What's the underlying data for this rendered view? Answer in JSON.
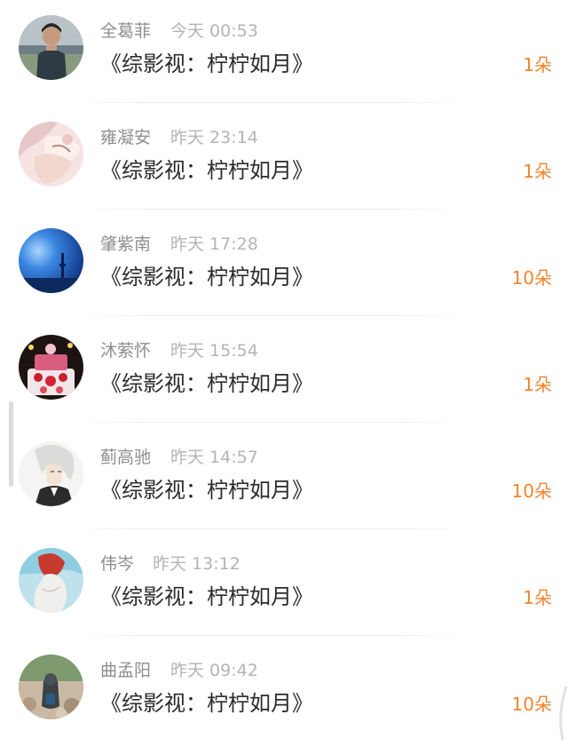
{
  "messages": [
    {
      "name": "全葛菲",
      "time": "今天 00:53",
      "title": "《综影视：柠柠如月》",
      "gift": "1朵",
      "avatar_icon": "avatar-man-outdoor"
    },
    {
      "name": "雍凝安",
      "time": "昨天 23:14",
      "title": "《综影视：柠柠如月》",
      "gift": "1朵",
      "avatar_icon": "avatar-anime-pastel"
    },
    {
      "name": "肇紫南",
      "time": "昨天 17:28",
      "title": "《综影视：柠柠如月》",
      "gift": "10朵",
      "avatar_icon": "avatar-blue-sky"
    },
    {
      "name": "沐萦怀",
      "time": "昨天 15:54",
      "title": "《综影视：柠柠如月》",
      "gift": "1朵",
      "avatar_icon": "avatar-birthday-cake"
    },
    {
      "name": "蓟高驰",
      "time": "昨天 14:57",
      "title": "《综影视：柠柠如月》",
      "gift": "10朵",
      "avatar_icon": "avatar-anime-white-hair"
    },
    {
      "name": "伟岑",
      "time": "昨天 13:12",
      "title": "《综影视：柠柠如月》",
      "gift": "1朵",
      "avatar_icon": "avatar-red-hair"
    },
    {
      "name": "曲孟阳",
      "time": "昨天 09:42",
      "title": "《综影视：柠柠如月》",
      "gift": "10朵",
      "avatar_icon": "avatar-otter-rocks"
    }
  ],
  "colors": {
    "gift": "#f0852e",
    "name": "#8e8e8e",
    "time": "#b4b4b4",
    "title": "#2b2b2b"
  }
}
